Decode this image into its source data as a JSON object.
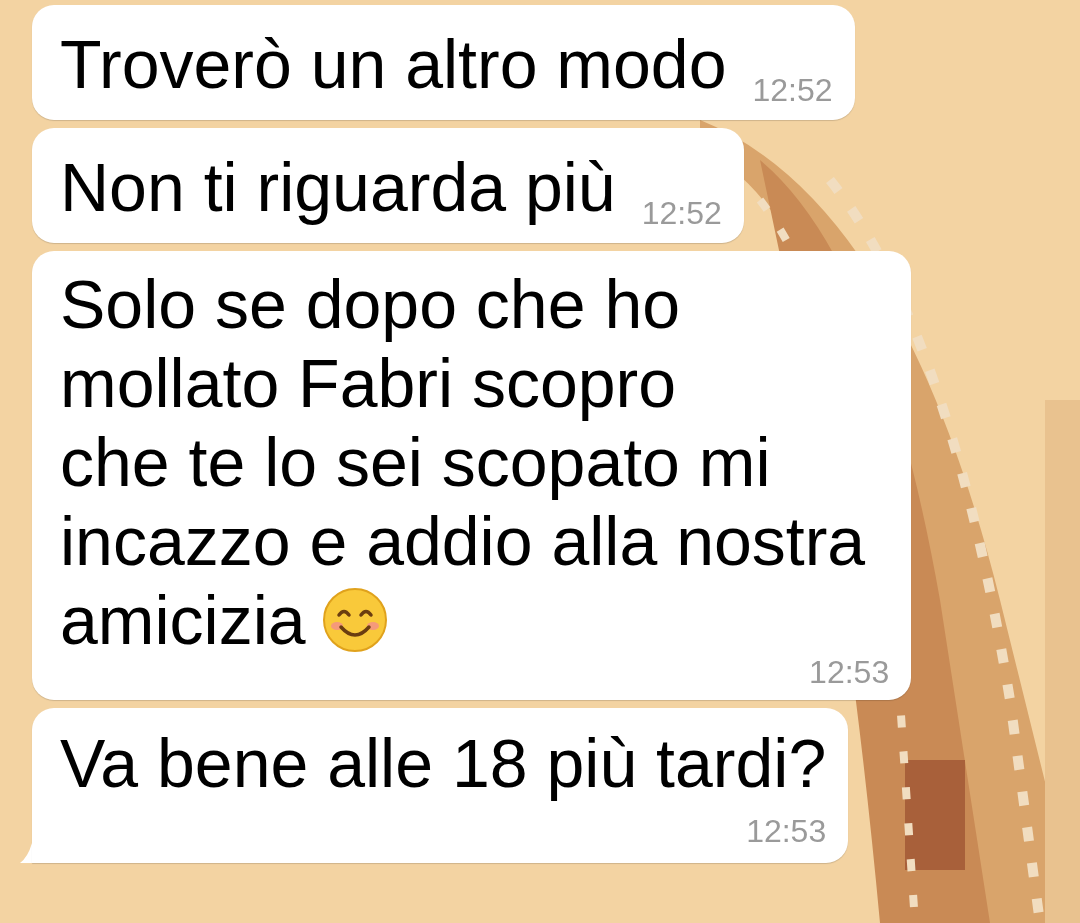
{
  "messages": [
    {
      "lines": [
        "Troverò un altro modo"
      ],
      "time": "12:52",
      "tail": false
    },
    {
      "lines": [
        "Non ti riguarda più"
      ],
      "time": "12:52",
      "tail": false
    },
    {
      "lines": [
        "Solo se dopo che ho",
        "mollato Fabri scopro",
        "che te lo sei scopato mi",
        "incazzo e addio alla nostra",
        "amicizia"
      ],
      "kind": "emoji_end",
      "time": "12:53",
      "tail": false
    },
    {
      "lines": [
        "Va bene alle 18 più tardi?"
      ],
      "time": "12:53",
      "tail": true
    }
  ]
}
